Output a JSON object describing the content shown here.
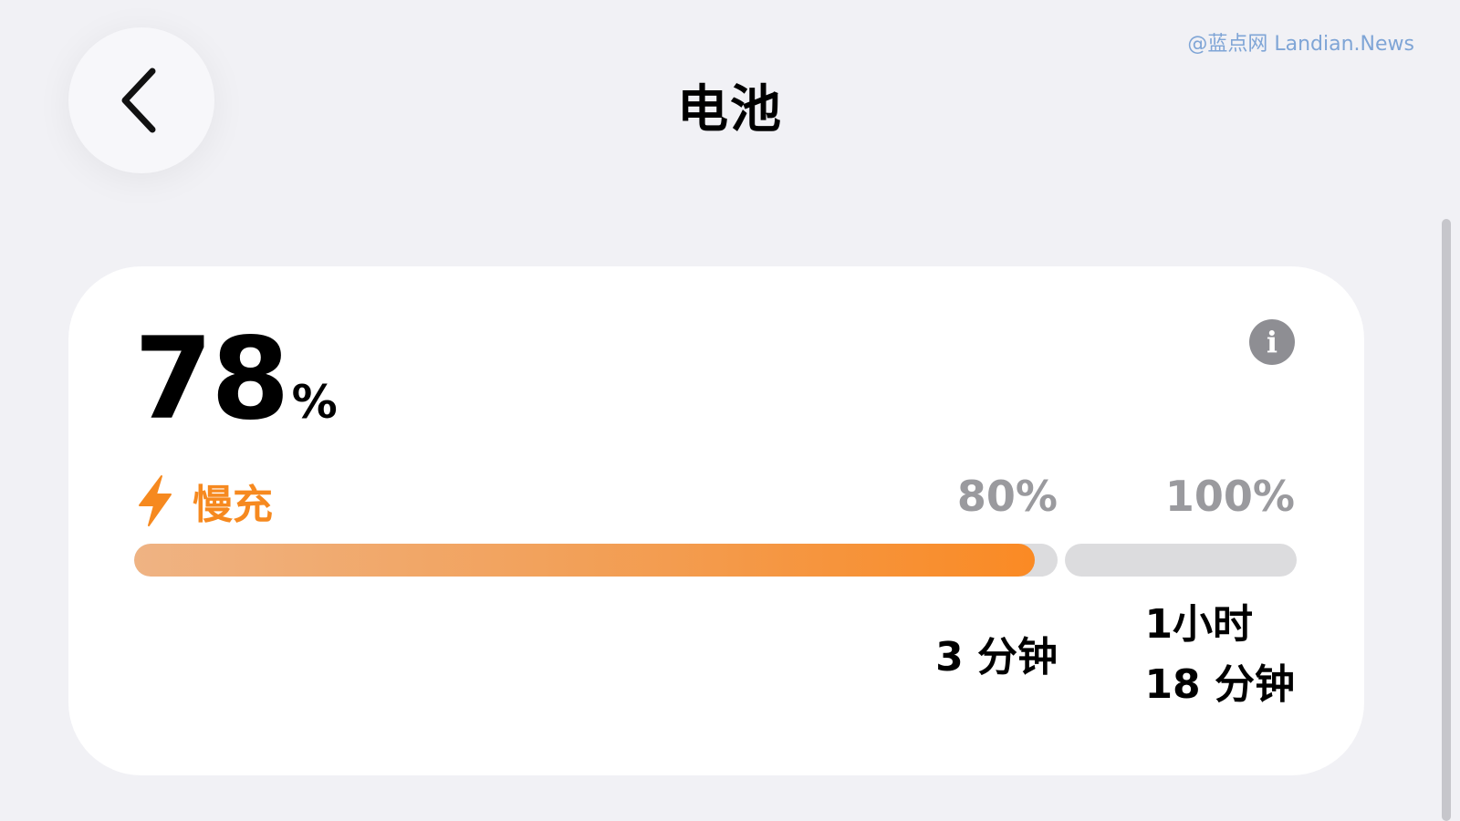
{
  "watermark": "@蓝点网 Landian.News",
  "header": {
    "title": "电池",
    "back_icon": "chevron-left-icon"
  },
  "battery": {
    "level_value": "78",
    "level_unit": "%",
    "level_fraction": 0.78,
    "info_icon": "info-icon",
    "info_glyph": "i",
    "charge_mode_icon": "lightning-bolt-icon",
    "charge_mode_label": "慢充",
    "accent_color": "#f6891f",
    "markers": {
      "eighty": "80%",
      "hundred": "100%"
    },
    "time_to_80": "3 分钟",
    "time_to_100_line1": "1小时",
    "time_to_100_line2": "18 分钟"
  }
}
